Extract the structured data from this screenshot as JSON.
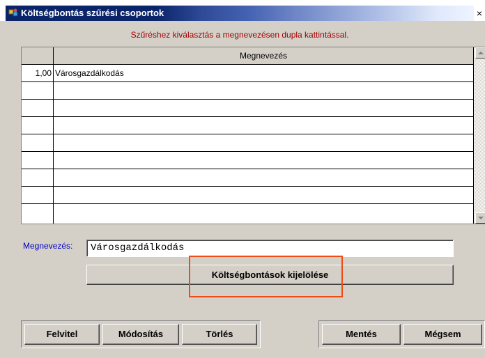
{
  "window": {
    "title": "Költségbontás szűrési csoportok",
    "close_glyph": "×"
  },
  "hint": "Szűréshez kiválasztás a megnevezésen dupla kattintással.",
  "grid": {
    "columns": [
      "",
      "Megnevezés"
    ],
    "rows": [
      [
        "1,00",
        "Városgazdálkodás"
      ],
      [
        "",
        ""
      ],
      [
        "",
        ""
      ],
      [
        "",
        ""
      ],
      [
        "",
        ""
      ],
      [
        "",
        ""
      ],
      [
        "",
        ""
      ],
      [
        "",
        ""
      ],
      [
        "",
        ""
      ]
    ]
  },
  "form": {
    "name_label": "Megnevezés:",
    "name_value": "Városgazdálkodás",
    "assign_button": "Költségbontások kijelölése"
  },
  "buttons": {
    "add": "Felvitel",
    "modify": "Módosítás",
    "delete": "Törlés",
    "save": "Mentés",
    "cancel": "Mégsem"
  },
  "colors": {
    "title_start": "#0a246a",
    "hint_text": "#a00000",
    "label_text": "#0000c0",
    "highlight": "#f04a16"
  },
  "icons": {
    "app": "app-icon",
    "close": "close-icon",
    "scroll_up": "scroll-up-icon",
    "scroll_down": "scroll-down-icon"
  }
}
